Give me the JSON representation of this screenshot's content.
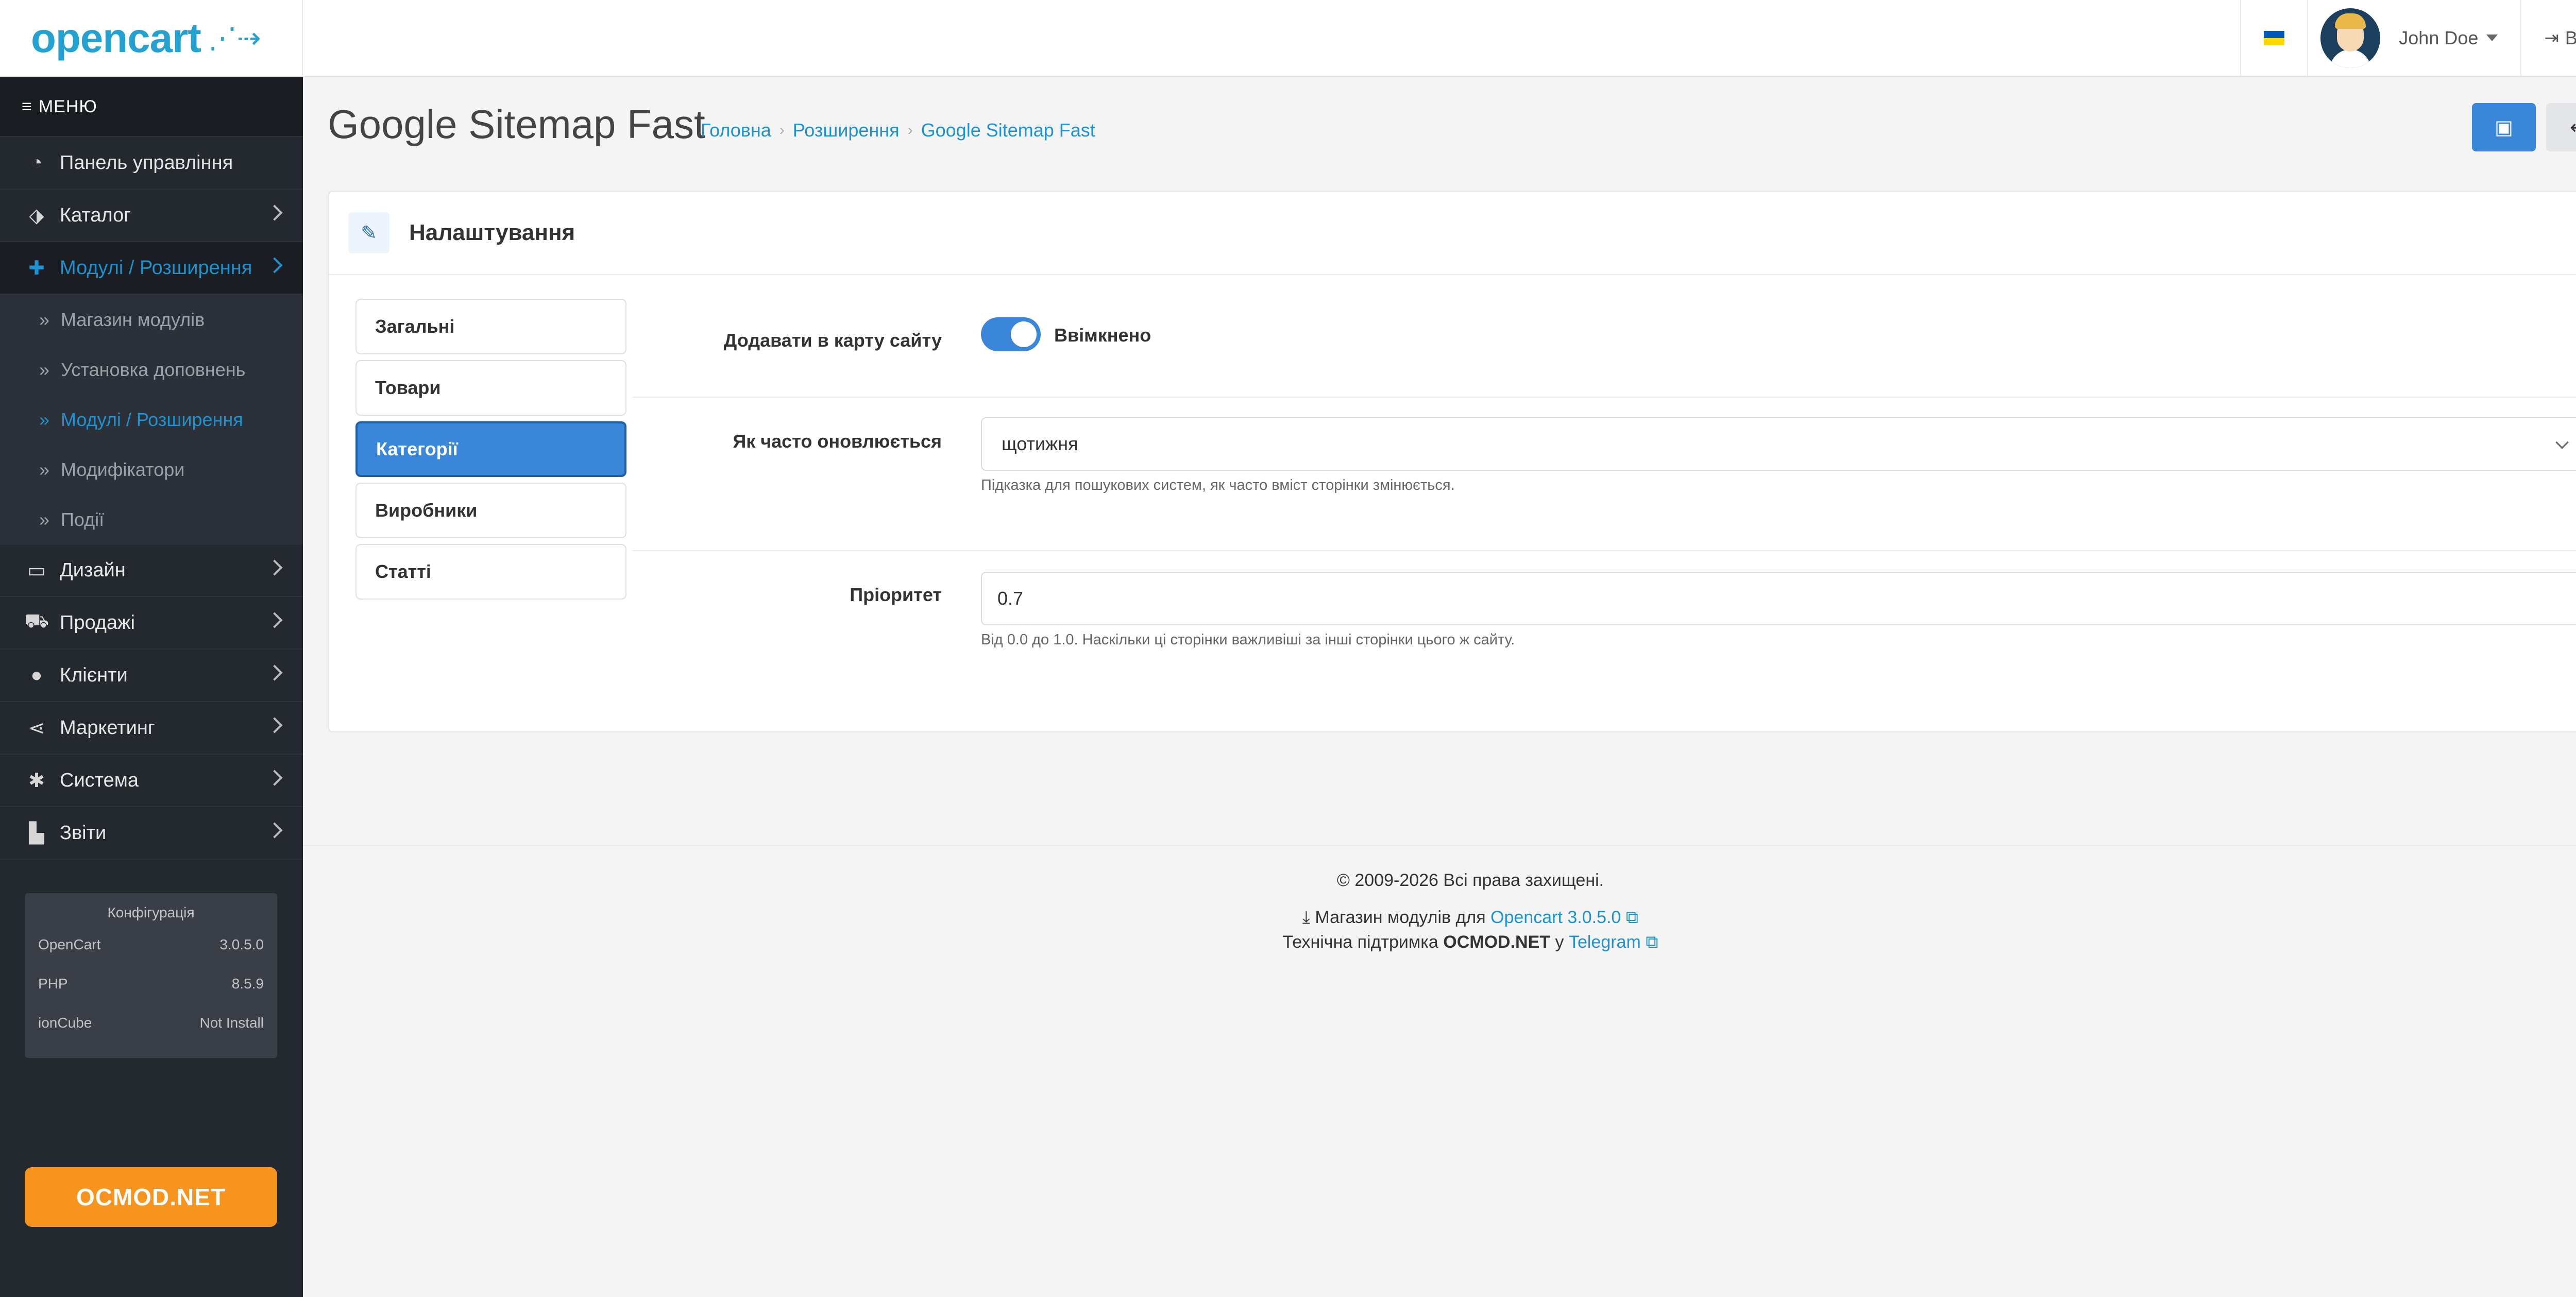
{
  "header": {
    "logo_text": "opencart",
    "user_name": "John Doe",
    "logout_label": "Вихід",
    "flag_colors": [
      "#0057b7",
      "#ffd700"
    ]
  },
  "sidebar": {
    "menu_title": "МЕНЮ",
    "items": [
      {
        "label": "Панель управління",
        "icon": "dashboard-icon"
      },
      {
        "label": "Каталог",
        "icon": "tags-icon"
      },
      {
        "label": "Модулі / Розширення",
        "icon": "puzzle-icon"
      },
      {
        "label": "Дизайн",
        "icon": "monitor-icon"
      },
      {
        "label": "Продажі",
        "icon": "cart-icon"
      },
      {
        "label": "Клієнти",
        "icon": "user-icon"
      },
      {
        "label": "Маркетинг",
        "icon": "share-icon"
      },
      {
        "label": "Система",
        "icon": "gear-icon"
      },
      {
        "label": "Звіти",
        "icon": "chart-icon"
      }
    ],
    "sub_items": [
      {
        "label": "Магазин модулів"
      },
      {
        "label": "Установка доповнень"
      },
      {
        "label": "Модулі / Розширення"
      },
      {
        "label": "Модифікатори"
      },
      {
        "label": "Події"
      }
    ],
    "config": {
      "title": "Конфігурація",
      "rows": [
        {
          "name": "OpenCart",
          "value": "3.0.5.0"
        },
        {
          "name": "PHP",
          "value": "8.5.9"
        },
        {
          "name": "ionCube",
          "value": "Not Install"
        }
      ]
    },
    "ocmod_button": "OCMOD.NET"
  },
  "page": {
    "title": "Google Sitemap Fast",
    "breadcrumb": [
      "Головна",
      "Розширення",
      "Google Sitemap Fast"
    ]
  },
  "card": {
    "title": "Налаштування",
    "tabs": [
      "Загальні",
      "Товари",
      "Категорії",
      "Виробники",
      "Статті"
    ],
    "active_tab": "Категорії",
    "fields": {
      "add_to_sitemap": {
        "label": "Додавати в карту сайту",
        "toggle_label": "Ввімкнено",
        "enabled": true
      },
      "changefreq": {
        "label": "Як часто оновлюється",
        "value": "щотижня",
        "help": "Підказка для пошукових систем, як часто вміст сторінки змінюється."
      },
      "priority": {
        "label": "Пріоритет",
        "value": "0.7",
        "help": "Від 0.0 до 1.0. Наскільки ці сторінки важливіші за інші сторінки цього ж сайту."
      }
    }
  },
  "footer": {
    "copyright": "© 2009-2026 Всі права захищені.",
    "store_prefix": "Магазин модулів для",
    "store_link": "Opencart 3.0.5.0",
    "support_prefix": "Технічна підтримка",
    "support_brand": "OCMOD.NET",
    "support_mid": "у",
    "support_link": "Telegram"
  },
  "colors": {
    "accent": "#3a86d8",
    "link": "#1e91cf",
    "sidebar_bg": "#24282f",
    "ocmod_orange": "#f7941d"
  }
}
